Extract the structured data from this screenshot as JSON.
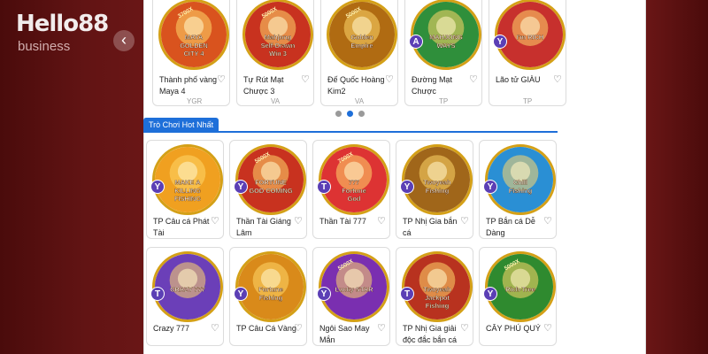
{
  "brand": {
    "logo_text": "Hello88",
    "tagline": "business"
  },
  "carousel": {
    "prev_icon": "‹",
    "next_icon": "›",
    "games": [
      {
        "name": "Thành phố vàng Maya 4",
        "provider": "YGR",
        "art_text": "MAYA GOLDEN CITY 4",
        "multiplier": "3700X",
        "color": "#d9531e",
        "badge": ""
      },
      {
        "name": "Tự Rút Mạt Chược 3",
        "provider": "VA",
        "art_text": "Mahjong Self-Drawn Win 3",
        "multiplier": "5000X",
        "color": "#c8321f",
        "badge": ""
      },
      {
        "name": "Đế Quốc Hoàng Kim2",
        "provider": "VA",
        "art_text": "Golden Empire",
        "multiplier": "5000X",
        "color": "#b06b12",
        "badge": ""
      },
      {
        "name": "Đường Mạt Chược",
        "provider": "TP",
        "art_text": "MAHJONG WAYS",
        "multiplier": "",
        "color": "#2f8f3b",
        "badge": "A"
      },
      {
        "name": "Lão tử GIÀU",
        "provider": "TP",
        "art_text": "I'm RICH",
        "multiplier": "",
        "color": "#c7302d",
        "badge": "Y"
      }
    ],
    "page_dots": 3,
    "active_dot": 1
  },
  "section": {
    "title": "Trò Chơi Hot Nhất"
  },
  "hot_games": [
    {
      "name": "TP Câu cá Phát Tài",
      "art_text": "MAKE A KILLING FISHING",
      "multiplier": "",
      "color": "#f0a020",
      "badge": "Y"
    },
    {
      "name": "Thần Tài Giáng Lâm",
      "art_text": "FORTUNE GOD COMING",
      "multiplier": "5000X",
      "color": "#c8321f",
      "badge": "Y"
    },
    {
      "name": "Thần Tài 777",
      "art_text": "777 Fortune God",
      "multiplier": "7000X",
      "color": "#d33",
      "badge": "T"
    },
    {
      "name": "TP Nhị Gia bắn cá",
      "art_text": "Twoyeah Fishing",
      "multiplier": "",
      "color": "#a0661a",
      "badge": "Y"
    },
    {
      "name": "TP Bắn cá Dễ Dàng",
      "art_text": "Chill Fishing",
      "multiplier": "",
      "color": "#2a8fd4",
      "badge": "Y"
    },
    {
      "name": "Crazy 777",
      "art_text": "CRAZY 777",
      "multiplier": "",
      "color": "#6b3fb8",
      "badge": "T"
    },
    {
      "name": "TP Câu Cá Vàng",
      "art_text": "Fortune Fishing",
      "multiplier": "",
      "color": "#d98a1a",
      "badge": "Y"
    },
    {
      "name": "Ngôi Sao May Mắn",
      "art_text": "Lucky STAR",
      "multiplier": "5000X",
      "color": "#7a2fb0",
      "badge": "Y"
    },
    {
      "name": "TP Nhị Gia giải độc đắc bắn cá",
      "art_text": "Twoyeah Jackpot Fishing",
      "multiplier": "",
      "color": "#b8321f",
      "badge": "T"
    },
    {
      "name": "CÂY PHÚ QUÝ",
      "art_text": "Rich-Tree",
      "multiplier": "5000X",
      "color": "#2f8a2f",
      "badge": "Y"
    }
  ],
  "icons": {
    "heart": "♡"
  }
}
